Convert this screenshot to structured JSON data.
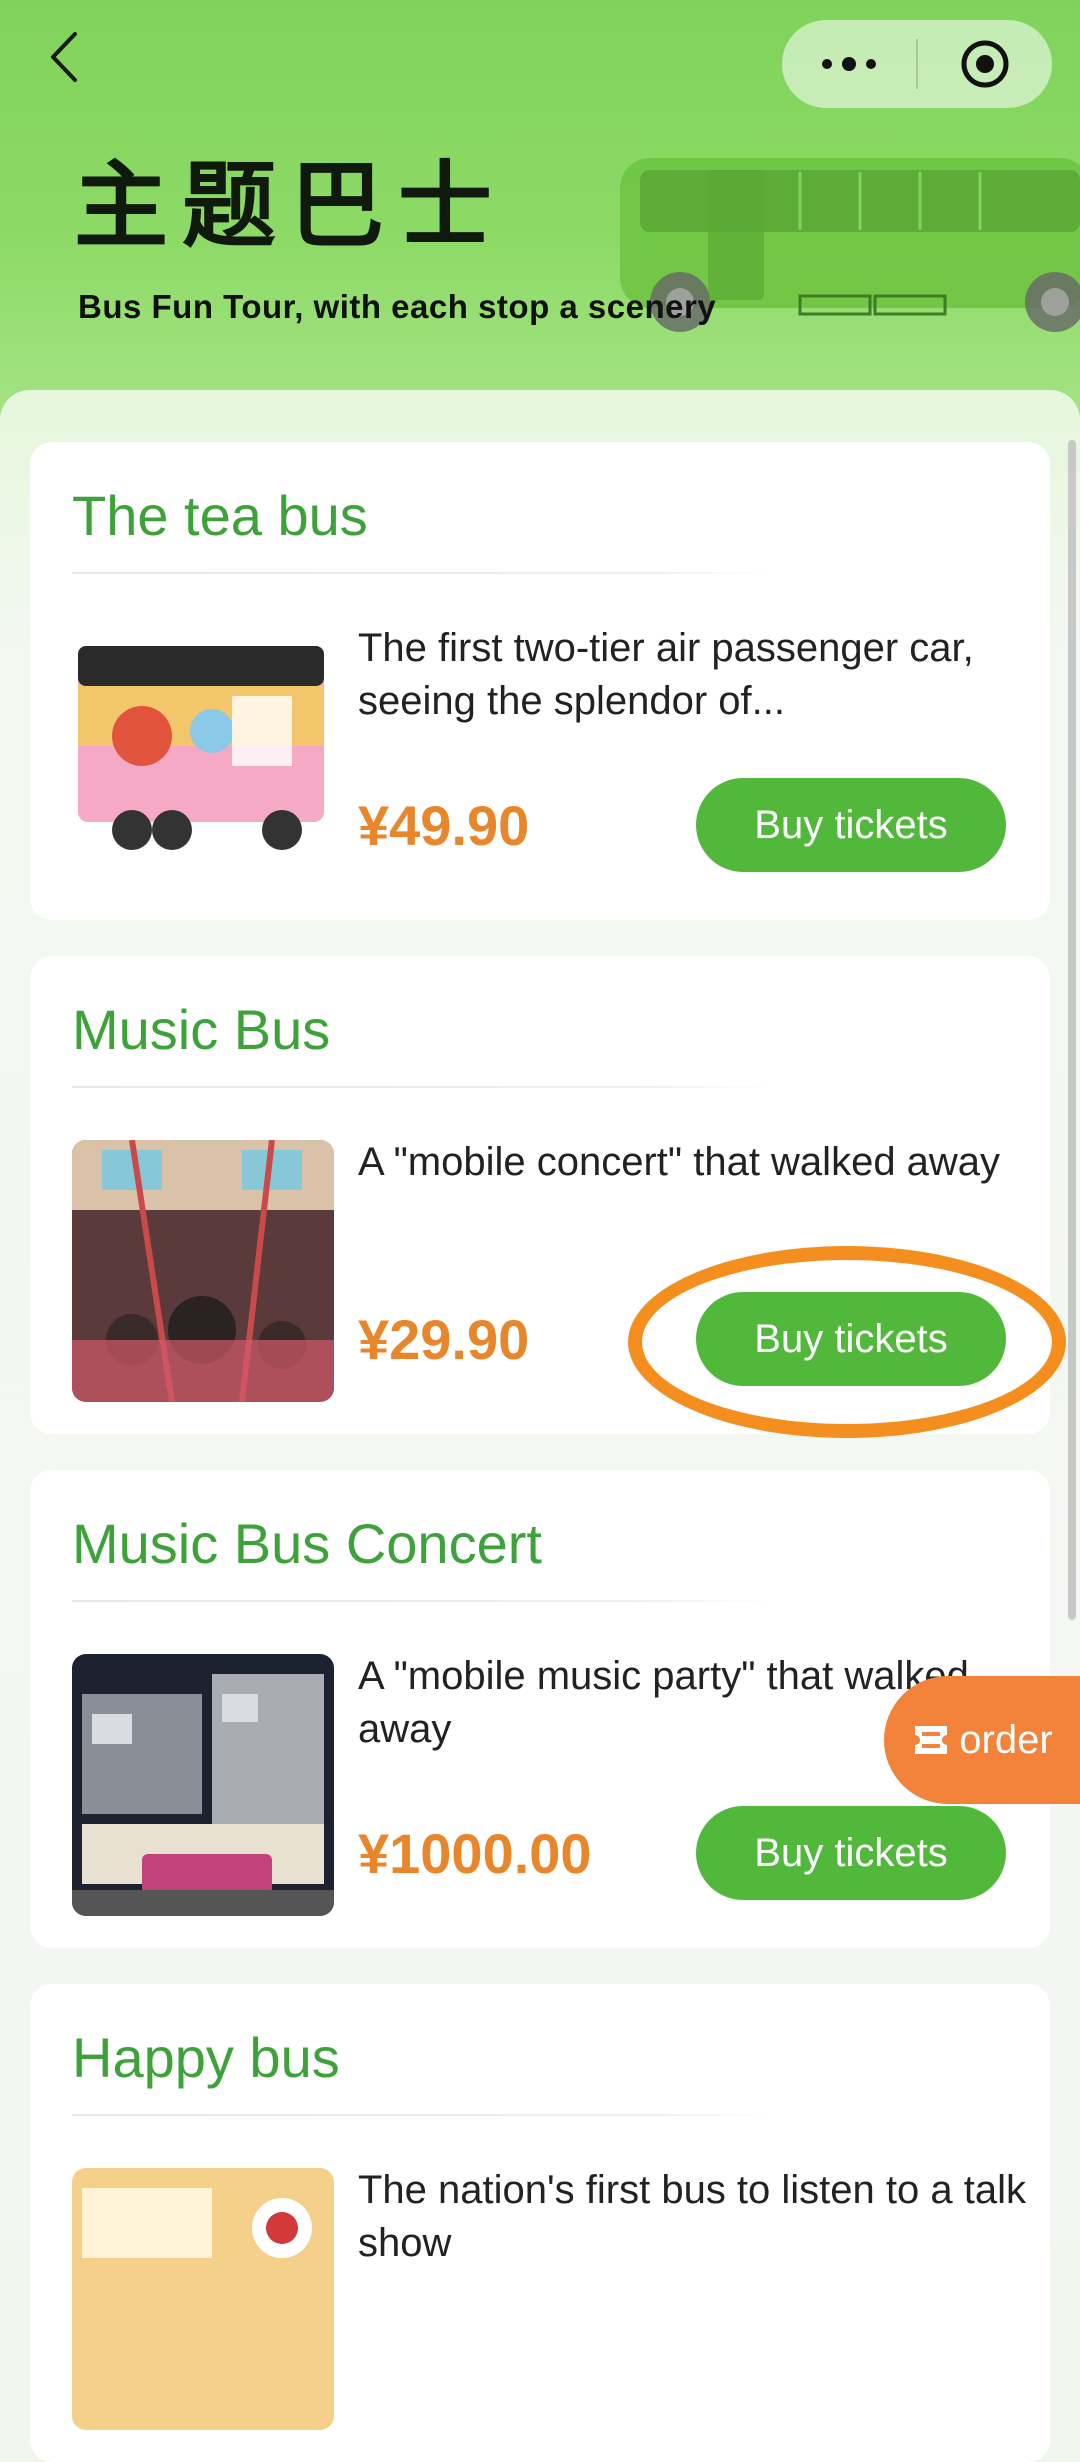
{
  "header": {
    "title": "主题巴士",
    "subtitle": "Bus Fun Tour, with each stop a scenery"
  },
  "nav": {
    "back_icon": "chevron-left-icon",
    "more_icon": "more-dots-icon",
    "close_icon": "target-icon"
  },
  "cards": [
    {
      "title": "The tea bus",
      "description": "The first two-tier air passenger car, seeing the splendor of...",
      "price": "¥49.90",
      "button": "Buy tickets"
    },
    {
      "title": "Music Bus",
      "description": "A \"mobile concert\" that walked away",
      "price": "¥29.90",
      "button": "Buy tickets"
    },
    {
      "title": "Music Bus Concert",
      "description": "A \"mobile music party\" that walked away",
      "price": "¥1000.00",
      "button": "Buy tickets"
    },
    {
      "title": "Happy bus",
      "description": "The nation's first bus to listen to a talk show",
      "price": "",
      "button": ""
    }
  ],
  "order_button": {
    "label": "order",
    "icon": "ticket-icon"
  },
  "colors": {
    "accent_green": "#52b83c",
    "title_green": "#3ea23a",
    "price_orange": "#e8862c",
    "highlight_orange": "#f48f1f"
  }
}
